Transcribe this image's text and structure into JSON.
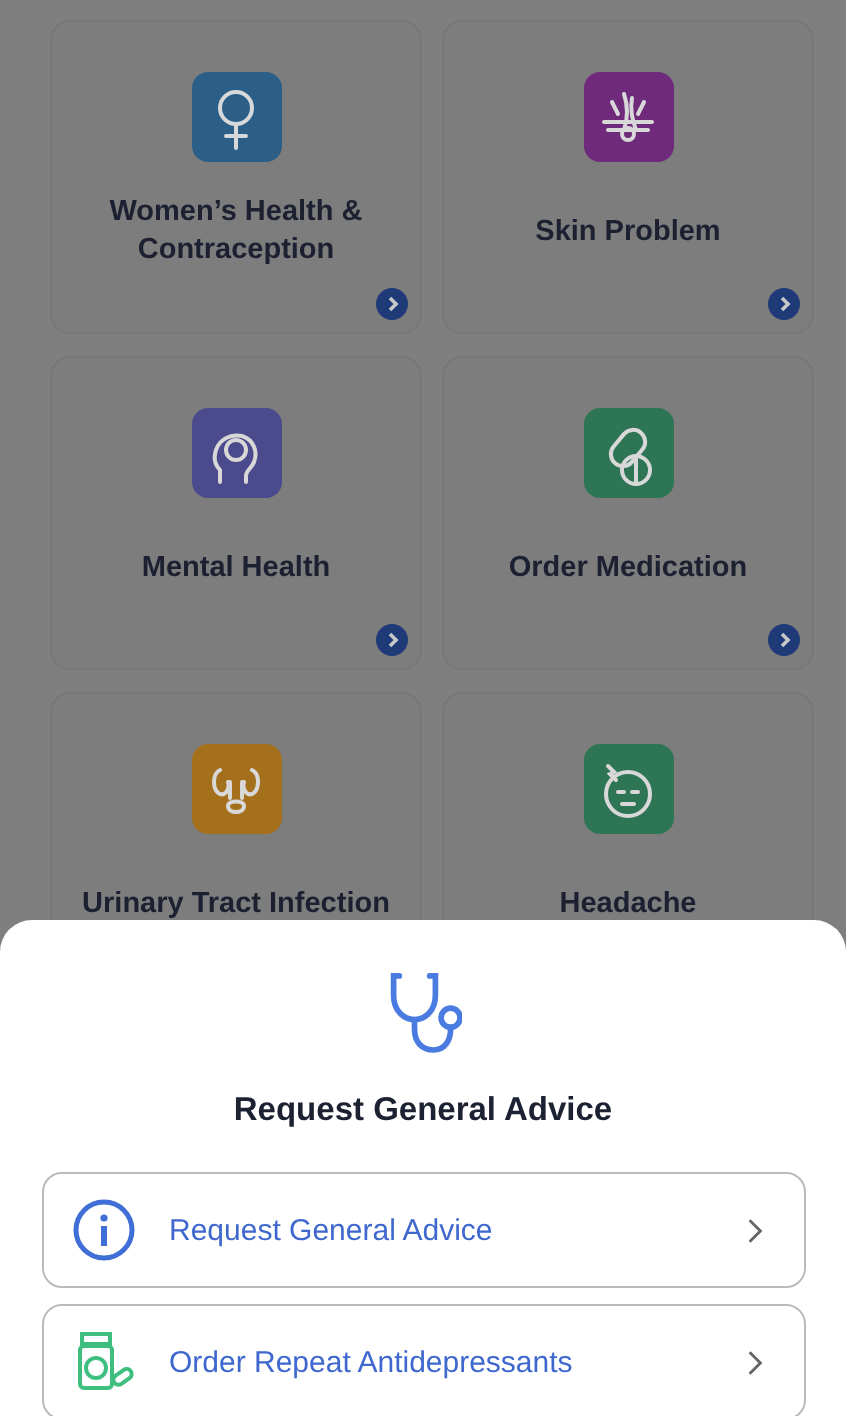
{
  "categories": [
    {
      "title": "Women’s Health & Contraception",
      "kind": "female",
      "color": "#2b5f88"
    },
    {
      "title": "Skin Problem",
      "kind": "hair",
      "color": "#6f2a7c"
    },
    {
      "title": "Mental Health",
      "kind": "head",
      "color": "#4b4a8c"
    },
    {
      "title": "Order Medication",
      "kind": "pills",
      "color": "#2e7555"
    },
    {
      "title": "Urinary Tract Infection",
      "kind": "kidney",
      "color": "#a4701c"
    },
    {
      "title": "Headache",
      "kind": "face",
      "color": "#2e7555"
    }
  ],
  "sheet": {
    "title": "Request General Advice",
    "options": [
      {
        "label": "Request General Advice",
        "kind": "info"
      },
      {
        "label": "Order Repeat Antidepressants",
        "kind": "bottle"
      }
    ]
  }
}
